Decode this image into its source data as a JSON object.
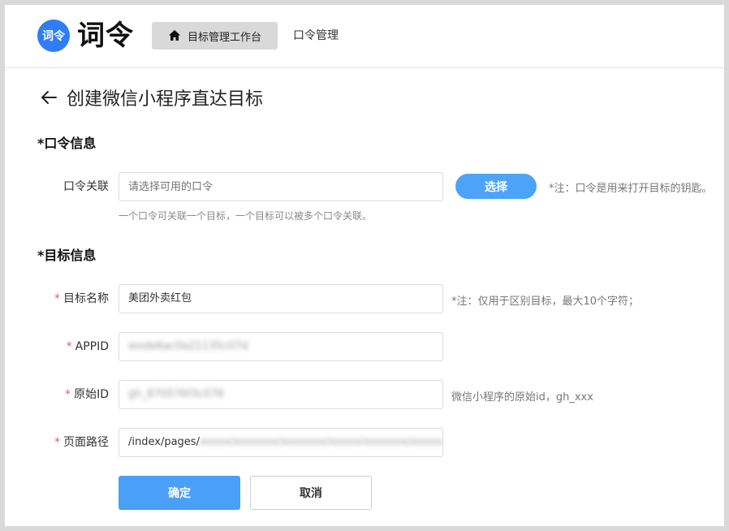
{
  "header": {
    "logo_mark": "词令",
    "logo_text": "词令",
    "nav_active_label": "目标管理工作台",
    "nav_item_label": "口令管理"
  },
  "page": {
    "title": "创建微信小程序直达目标"
  },
  "section_password": {
    "heading": "*口令信息",
    "field_label": "口令关联",
    "input_placeholder": "请选择可用的口令",
    "select_button": "选择",
    "note": "*注：口令是用来打开目标的钥匙。",
    "help_text": "一个口令可关联一个目标，一个目标可以被多个口令关联。"
  },
  "section_target": {
    "heading": "*目标信息",
    "required_mark": "*",
    "fields": [
      {
        "label": "目标名称",
        "value": "美团外卖红包",
        "note": "*注：仅用于区别目标，最大10个字符；"
      },
      {
        "label": "APPID",
        "value": "wxde6ac0a21135c07d",
        "note": ""
      },
      {
        "label": "原始ID",
        "value": "gh_870576f3c078",
        "note": "微信小程序的原始id，gh_xxx"
      },
      {
        "label": "页面路径",
        "value_prefix": "/index/pages/",
        "value_rest": "xxxxx/xxxxxxx/xxxxxxx/xxxxx/xxxxxxx/xxxxx",
        "note": ""
      }
    ]
  },
  "actions": {
    "confirm": "确定",
    "cancel": "取消"
  },
  "colors": {
    "primary": "#4a9ff7",
    "logo_blue": "#2f7df6",
    "required": "#e45c5c"
  },
  "icons": {
    "home": "home-icon",
    "back": "arrow-left-icon"
  }
}
